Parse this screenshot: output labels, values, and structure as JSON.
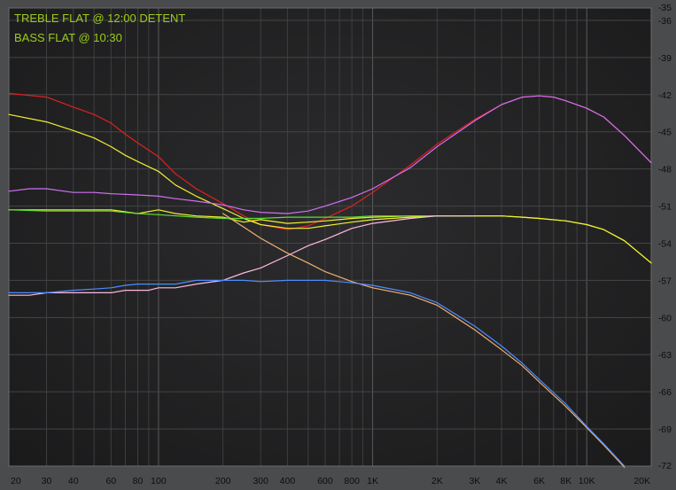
{
  "chart_data": {
    "type": "line",
    "title": "",
    "xlabel": "",
    "ylabel": "",
    "x_scale": "log",
    "xlim": [
      20,
      20000
    ],
    "ylim": [
      -72,
      -35
    ],
    "grid": true,
    "annotations": [
      "TREBLE FLAT @ 12:00 DETENT",
      "BASS FLAT @ 10:30"
    ],
    "x_ticks": [
      {
        "value": 20,
        "label": "20"
      },
      {
        "value": 30,
        "label": "30"
      },
      {
        "value": 40,
        "label": "40"
      },
      {
        "value": 60,
        "label": "60"
      },
      {
        "value": 80,
        "label": "80"
      },
      {
        "value": 100,
        "label": "100"
      },
      {
        "value": 200,
        "label": "200"
      },
      {
        "value": 300,
        "label": "300"
      },
      {
        "value": 400,
        "label": "400"
      },
      {
        "value": 600,
        "label": "600"
      },
      {
        "value": 800,
        "label": "800"
      },
      {
        "value": 1000,
        "label": "1K"
      },
      {
        "value": 2000,
        "label": "2K"
      },
      {
        "value": 3000,
        "label": "3K"
      },
      {
        "value": 4000,
        "label": "4K"
      },
      {
        "value": 6000,
        "label": "6K"
      },
      {
        "value": 8000,
        "label": "8K"
      },
      {
        "value": 10000,
        "label": "10K"
      },
      {
        "value": 20000,
        "label": "20K"
      }
    ],
    "y_ticks": [
      -35,
      -36,
      -39,
      -42,
      -45,
      -48,
      -51,
      -54,
      -57,
      -60,
      -63,
      -66,
      -69,
      -72
    ],
    "series": [
      {
        "color": "#e02020",
        "points": [
          [
            20,
            -41.9
          ],
          [
            30,
            -42.2
          ],
          [
            40,
            -43.0
          ],
          [
            50,
            -43.6
          ],
          [
            60,
            -44.3
          ],
          [
            70,
            -45.2
          ],
          [
            80,
            -45.9
          ],
          [
            100,
            -47.0
          ],
          [
            120,
            -48.4
          ],
          [
            150,
            -49.6
          ],
          [
            200,
            -50.8
          ],
          [
            250,
            -51.8
          ],
          [
            300,
            -52.5
          ],
          [
            400,
            -52.9
          ],
          [
            500,
            -52.6
          ],
          [
            600,
            -52.0
          ],
          [
            800,
            -51.0
          ],
          [
            1000,
            -49.9
          ],
          [
            1500,
            -47.7
          ],
          [
            2000,
            -46.0
          ],
          [
            3000,
            -44.0
          ],
          [
            4000,
            -42.8
          ],
          [
            5000,
            -42.2
          ],
          [
            6000,
            -42.1
          ],
          [
            7000,
            -42.2
          ],
          [
            8000,
            -42.5
          ],
          [
            10000,
            -43.1
          ],
          [
            12000,
            -43.8
          ],
          [
            15000,
            -45.3
          ],
          [
            20000,
            -47.5
          ]
        ]
      },
      {
        "color": "#f0f030",
        "points": [
          [
            20,
            -43.6
          ],
          [
            30,
            -44.2
          ],
          [
            40,
            -44.9
          ],
          [
            50,
            -45.5
          ],
          [
            60,
            -46.2
          ],
          [
            70,
            -46.9
          ],
          [
            80,
            -47.4
          ],
          [
            100,
            -48.2
          ],
          [
            120,
            -49.3
          ],
          [
            150,
            -50.2
          ],
          [
            200,
            -51.2
          ],
          [
            250,
            -52.0
          ],
          [
            300,
            -52.5
          ],
          [
            400,
            -52.8
          ],
          [
            500,
            -52.8
          ],
          [
            600,
            -52.6
          ],
          [
            800,
            -52.3
          ],
          [
            1000,
            -52.1
          ],
          [
            1500,
            -51.9
          ],
          [
            2000,
            -51.8
          ],
          [
            3000,
            -51.8
          ],
          [
            4000,
            -51.8
          ],
          [
            5000,
            -51.9
          ],
          [
            6000,
            -52.0
          ],
          [
            8000,
            -52.2
          ],
          [
            10000,
            -52.5
          ],
          [
            12000,
            -52.9
          ],
          [
            15000,
            -53.8
          ],
          [
            20000,
            -55.6
          ]
        ]
      },
      {
        "color": "#d070f0",
        "points": [
          [
            20,
            -49.8
          ],
          [
            25,
            -49.6
          ],
          [
            30,
            -49.6
          ],
          [
            40,
            -49.9
          ],
          [
            50,
            -49.9
          ],
          [
            60,
            -50.0
          ],
          [
            80,
            -50.1
          ],
          [
            100,
            -50.2
          ],
          [
            120,
            -50.4
          ],
          [
            150,
            -50.6
          ],
          [
            200,
            -50.9
          ],
          [
            250,
            -51.3
          ],
          [
            300,
            -51.5
          ],
          [
            400,
            -51.6
          ],
          [
            500,
            -51.4
          ],
          [
            600,
            -51.0
          ],
          [
            800,
            -50.3
          ],
          [
            1000,
            -49.6
          ],
          [
            1500,
            -47.9
          ],
          [
            2000,
            -46.2
          ],
          [
            3000,
            -44.1
          ],
          [
            4000,
            -42.8
          ],
          [
            5000,
            -42.2
          ],
          [
            6000,
            -42.1
          ],
          [
            7000,
            -42.2
          ],
          [
            8000,
            -42.5
          ],
          [
            10000,
            -43.1
          ],
          [
            12000,
            -43.8
          ],
          [
            15000,
            -45.3
          ],
          [
            20000,
            -47.5
          ]
        ]
      },
      {
        "color": "#f0f030",
        "points": [
          [
            20,
            -51.3
          ],
          [
            30,
            -51.3
          ],
          [
            40,
            -51.3
          ],
          [
            60,
            -51.3
          ],
          [
            80,
            -51.6
          ],
          [
            100,
            -51.3
          ],
          [
            120,
            -51.6
          ],
          [
            150,
            -51.8
          ],
          [
            200,
            -51.9
          ],
          [
            250,
            -52.3
          ],
          [
            300,
            -52.1
          ],
          [
            400,
            -52.4
          ],
          [
            500,
            -52.3
          ],
          [
            600,
            -52.2
          ],
          [
            800,
            -52.0
          ],
          [
            1000,
            -51.9
          ],
          [
            1500,
            -51.8
          ],
          [
            2000,
            -51.8
          ],
          [
            3000,
            -51.8
          ],
          [
            4000,
            -51.8
          ],
          [
            5000,
            -51.9
          ],
          [
            6000,
            -52.0
          ],
          [
            8000,
            -52.2
          ],
          [
            10000,
            -52.5
          ],
          [
            12000,
            -52.9
          ],
          [
            15000,
            -53.8
          ],
          [
            20000,
            -55.6
          ]
        ]
      },
      {
        "color": "#60dd30",
        "points": [
          [
            20,
            -51.3
          ],
          [
            30,
            -51.4
          ],
          [
            40,
            -51.4
          ],
          [
            60,
            -51.4
          ],
          [
            80,
            -51.6
          ],
          [
            100,
            -51.7
          ],
          [
            150,
            -51.9
          ],
          [
            200,
            -52.0
          ],
          [
            250,
            -52.0
          ],
          [
            300,
            -52.0
          ],
          [
            400,
            -51.9
          ],
          [
            500,
            -51.9
          ],
          [
            600,
            -51.9
          ],
          [
            800,
            -51.9
          ],
          [
            1000,
            -51.8
          ],
          [
            1500,
            -51.8
          ],
          [
            2000,
            -51.8
          ],
          [
            3000,
            -51.8
          ]
        ]
      },
      {
        "color": "#ffb8e0",
        "points": [
          [
            20,
            -58.2
          ],
          [
            25,
            -58.2
          ],
          [
            30,
            -58.0
          ],
          [
            40,
            -58.0
          ],
          [
            50,
            -58.0
          ],
          [
            60,
            -58.0
          ],
          [
            70,
            -57.8
          ],
          [
            80,
            -57.8
          ],
          [
            90,
            -57.8
          ],
          [
            100,
            -57.6
          ],
          [
            120,
            -57.6
          ],
          [
            150,
            -57.3
          ],
          [
            200,
            -57.0
          ],
          [
            250,
            -56.4
          ],
          [
            300,
            -56.0
          ],
          [
            400,
            -55.0
          ],
          [
            500,
            -54.2
          ],
          [
            600,
            -53.7
          ],
          [
            800,
            -52.8
          ],
          [
            1000,
            -52.4
          ],
          [
            1500,
            -52.0
          ],
          [
            2000,
            -51.8
          ],
          [
            3000,
            -51.8
          ]
        ]
      },
      {
        "color": "#f0b070",
        "points": [
          [
            200,
            -51.6
          ],
          [
            250,
            -52.7
          ],
          [
            300,
            -53.6
          ],
          [
            400,
            -54.8
          ],
          [
            500,
            -55.6
          ],
          [
            600,
            -56.3
          ],
          [
            800,
            -57.1
          ],
          [
            1000,
            -57.6
          ],
          [
            1500,
            -58.2
          ],
          [
            2000,
            -59.0
          ],
          [
            3000,
            -61.0
          ],
          [
            4000,
            -62.6
          ],
          [
            5000,
            -63.9
          ],
          [
            6000,
            -65.2
          ],
          [
            8000,
            -67.2
          ],
          [
            10000,
            -68.9
          ],
          [
            12000,
            -70.3
          ],
          [
            15000,
            -72.1
          ]
        ]
      },
      {
        "color": "#4c8cff",
        "points": [
          [
            20,
            -58.0
          ],
          [
            30,
            -58.0
          ],
          [
            40,
            -57.8
          ],
          [
            50,
            -57.7
          ],
          [
            60,
            -57.6
          ],
          [
            70,
            -57.4
          ],
          [
            80,
            -57.3
          ],
          [
            100,
            -57.3
          ],
          [
            120,
            -57.3
          ],
          [
            150,
            -57.0
          ],
          [
            200,
            -57.0
          ],
          [
            250,
            -57.0
          ],
          [
            300,
            -57.1
          ],
          [
            400,
            -57.0
          ],
          [
            500,
            -57.0
          ],
          [
            600,
            -57.0
          ],
          [
            800,
            -57.2
          ],
          [
            1000,
            -57.4
          ],
          [
            1500,
            -58.0
          ],
          [
            2000,
            -58.8
          ],
          [
            3000,
            -60.7
          ],
          [
            4000,
            -62.3
          ],
          [
            5000,
            -63.7
          ],
          [
            6000,
            -65.0
          ],
          [
            8000,
            -67.0
          ],
          [
            10000,
            -68.8
          ],
          [
            12000,
            -70.2
          ],
          [
            15000,
            -72.0
          ]
        ]
      }
    ]
  }
}
